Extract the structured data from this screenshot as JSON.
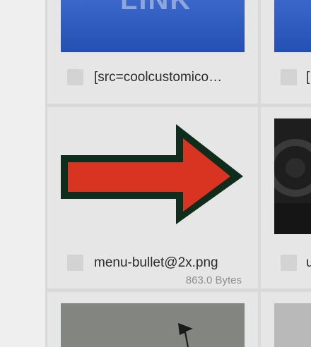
{
  "files": [
    {
      "name": "[src=coolcustomico…",
      "size": "",
      "thumbnail": "blue-link-banner",
      "thumbnail_text": "LINK"
    },
    {
      "name": "[",
      "size": "",
      "thumbnail": "blue-banner"
    },
    {
      "name": "menu-bullet@2x.png",
      "size": "863.0 Bytes",
      "thumbnail": "red-arrow-icon"
    },
    {
      "name": "u",
      "size": "",
      "thumbnail": "dark-pattern"
    },
    {
      "name": "",
      "size": "",
      "thumbnail": "gray-cursor-image"
    },
    {
      "name": "",
      "size": "",
      "thumbnail": "gray-image"
    }
  ],
  "colors": {
    "blue": "#2a55b8",
    "red_arrow": "#d93422",
    "arrow_outline": "#0f2d1c",
    "dark_thumb": "#1e1e1e",
    "gray_thumb": "#838580"
  }
}
